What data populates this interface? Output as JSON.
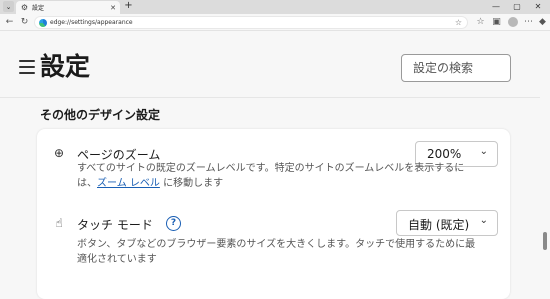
{
  "tab": {
    "title": "設定"
  },
  "address_bar": {
    "url": "edge://settings/appearance"
  },
  "settings": {
    "title": "設定",
    "search_placeholder": "設定の検索",
    "section_title": "その他のデザイン設定"
  },
  "zoom": {
    "label": "ページのズーム",
    "value": "200%",
    "desc_line1": "すべてのサイトの既定のズームレベルです。特定のサイトのズームレベルを表示するに",
    "desc_line2_prefix": "は、",
    "desc_link": "ズーム レベル",
    "desc_line2_suffix": " に移動します"
  },
  "touch": {
    "label": "タッチ モード",
    "help": "?",
    "value": "自動 (既定)",
    "desc_line1": "ボタン、タブなどのブラウザー要素のサイズを大きくします。タッチで使用するために最",
    "desc_line2": "適化されています"
  }
}
